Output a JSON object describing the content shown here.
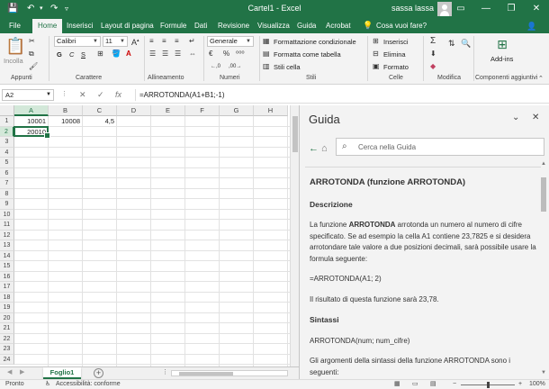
{
  "titlebar": {
    "title": "Cartel1 - Excel",
    "user": "sassa lassa",
    "save_icon": "save-icon",
    "undo_icon": "undo-icon",
    "redo_icon": "redo-icon"
  },
  "tabs": [
    {
      "label": "File"
    },
    {
      "label": "Home"
    },
    {
      "label": "Inserisci"
    },
    {
      "label": "Layout di pagina"
    },
    {
      "label": "Formule"
    },
    {
      "label": "Dati"
    },
    {
      "label": "Revisione"
    },
    {
      "label": "Visualizza"
    },
    {
      "label": "Guida"
    },
    {
      "label": "Acrobat"
    }
  ],
  "tell_me": "Cosa vuoi fare?",
  "ribbon": {
    "paste_label": "Incolla",
    "font_name": "Calibri",
    "font_size": "11",
    "bold": "G",
    "italic": "C",
    "underline": "S",
    "number_format": "Generale",
    "conditional_formatting": "Formattazione condizionale",
    "format_as_table": "Formatta come tabella",
    "cell_styles": "Stili cella",
    "insert": "Inserisci",
    "delete": "Elimina",
    "format": "Formato",
    "addins": "Add-ins",
    "groups": {
      "clipboard": "Appunti",
      "font": "Carattere",
      "alignment": "Allineamento",
      "number": "Numeri",
      "styles": "Stili",
      "cells": "Celle",
      "editing": "Modifica",
      "addins": "Componenti aggiuntivi"
    }
  },
  "formula_bar": {
    "name_box": "A2",
    "cancel": "✕",
    "enter": "✓",
    "fx": "fx",
    "formula": "=ARROTONDA(A1+B1;-1)"
  },
  "grid": {
    "columns": [
      "A",
      "B",
      "C",
      "D",
      "E",
      "F",
      "G",
      "H"
    ],
    "rows": [
      "1",
      "2",
      "3",
      "4",
      "5",
      "6",
      "7",
      "8",
      "9",
      "10",
      "11",
      "12",
      "13",
      "14",
      "15",
      "16",
      "17",
      "18",
      "19",
      "20",
      "21",
      "22",
      "23",
      "24"
    ],
    "cells": {
      "A1": "10001",
      "B1": "10008",
      "C1": "4,5",
      "A2": "20010"
    }
  },
  "sheet_tabs": {
    "active": "Foglio1",
    "add": "+"
  },
  "help_pane": {
    "title": "Guida",
    "search_placeholder": "Cerca nella Guida",
    "article_title": "ARROTONDA (funzione ARROTONDA)",
    "description_heading": "Descrizione",
    "description_intro": "La funzione ",
    "description_bold": "ARROTONDA",
    "description_rest": " arrotonda un numero al numero di cifre specificato. Se ad esempio la cella A1 contiene 23,7825 e si desidera arrotondare tale valore a due posizioni decimali, sarà possibile usare la formula seguente:",
    "formula_example": "=ARROTONDA(A1; 2)",
    "result_text": "Il risultato di questa funzione sarà 23,78.",
    "syntax_heading": "Sintassi",
    "syntax": "ARROTONDA(num; num_cifre)",
    "args_text": "Gli argomenti della sintassi della funzione ARROTONDA sono i seguenti:"
  },
  "statusbar": {
    "ready": "Pronto",
    "accessibility": "Accessibilità: conforme",
    "zoom": "100%",
    "zoom_minus": "−",
    "zoom_plus": "+"
  },
  "colors": {
    "accent": "#217346",
    "ribbon_bg": "#f3f3f3",
    "pane_bg": "#f3f3f3"
  }
}
